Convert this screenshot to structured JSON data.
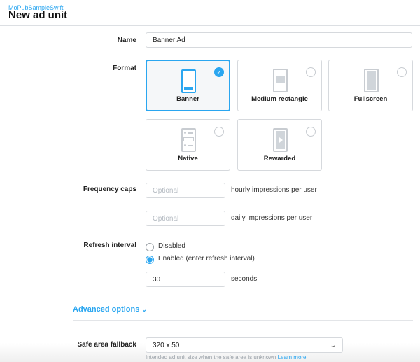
{
  "header": {
    "app_name": "MoPubSampleSwift",
    "title": "New ad unit"
  },
  "form": {
    "name": {
      "label": "Name",
      "value": "Banner Ad"
    },
    "format": {
      "label": "Format",
      "options": [
        {
          "label": "Banner",
          "selected": true,
          "icon": "banner-phone-icon"
        },
        {
          "label": "Medium rectangle",
          "selected": false,
          "icon": "medium-rectangle-phone-icon"
        },
        {
          "label": "Fullscreen",
          "selected": false,
          "icon": "fullscreen-phone-icon"
        },
        {
          "label": "Native",
          "selected": false,
          "icon": "native-phone-icon"
        },
        {
          "label": "Rewarded",
          "selected": false,
          "icon": "rewarded-phone-icon"
        }
      ]
    },
    "frequency_caps": {
      "label": "Frequency caps",
      "hourly": {
        "placeholder": "Optional",
        "suffix": "hourly impressions per user"
      },
      "daily": {
        "placeholder": "Optional",
        "suffix": "daily impressions per user"
      }
    },
    "refresh_interval": {
      "label": "Refresh interval",
      "options": [
        {
          "label": "Disabled",
          "selected": false
        },
        {
          "label": "Enabled (enter refresh interval)",
          "selected": true
        }
      ],
      "value": "30",
      "suffix": "seconds"
    },
    "advanced": {
      "label": "Advanced options"
    },
    "safe_area": {
      "label": "Safe area fallback",
      "value": "320 x 50",
      "help": "Intended ad unit size when the safe area is unknown",
      "learn_more": "Learn more"
    }
  },
  "colors": {
    "accent": "#2aa6f0",
    "border": "#d6d9dd"
  }
}
